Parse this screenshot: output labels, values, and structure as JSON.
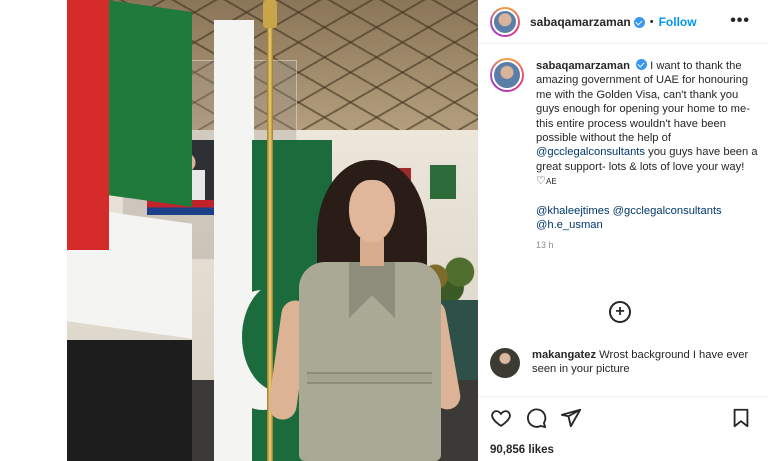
{
  "post": {
    "username": "sabaqamarzaman",
    "separator": "•",
    "follow_label": "Follow",
    "more_label": "•••",
    "caption": {
      "username": "sabaqamarzaman",
      "text_1": "I want to thank the amazing government of UAE for honouring me with the Golden Visa, can't thank you guys enough for opening your home to me- this entire process wouldn't have been possible without the help of",
      "mention_1": "@gcclegalconsultants",
      "text_2": "you guys have been a great support- lots & lots of love your way! ♡",
      "text_2_suffix": "AE",
      "tag_1": "@khaleejtimes",
      "tag_2": "@gcclegalconsultants",
      "tag_3": "@h.e_usman",
      "time": "13 h"
    },
    "comment": {
      "username": "makangatez",
      "text": "Wrost background I have ever seen in your picture"
    },
    "likes": "90,856 likes",
    "carousel_next": "›",
    "add_comment_icon": "+"
  },
  "icons": {
    "heart": "heart-icon",
    "comment": "comment-icon",
    "share": "paper-plane-icon",
    "save": "bookmark-icon"
  },
  "colors": {
    "link": "#0095f6",
    "mention": "#00376b",
    "verified": "#3897f0",
    "text": "#262626",
    "muted": "#8e8e8e"
  }
}
